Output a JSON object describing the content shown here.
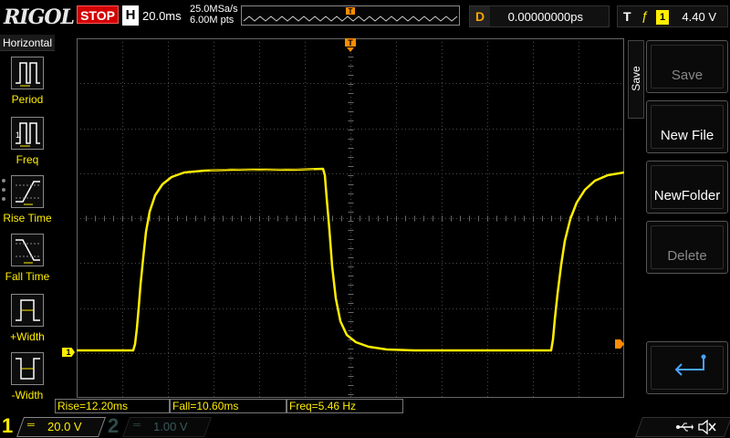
{
  "header": {
    "logo": "RIGOL",
    "run_status": "STOP",
    "timebase_letter": "H",
    "timebase": "20.0ms",
    "sample_rate": "25.0MSa/s",
    "memory_depth": "6.00M pts",
    "delay_letter": "D",
    "delay": "0.00000000ps",
    "trigger_letter": "T",
    "trigger_source": "1",
    "trigger_level": "4.40 V"
  },
  "left_menu": {
    "title": "Horizontal",
    "items": [
      {
        "label": "Period",
        "icon": "period-icon"
      },
      {
        "label": "Freq",
        "icon": "freq-icon"
      },
      {
        "label": "Rise Time",
        "icon": "rise-time-icon"
      },
      {
        "label": "Fall Time",
        "icon": "fall-time-icon"
      },
      {
        "label": "+Width",
        "icon": "plus-width-icon"
      },
      {
        "label": "-Width",
        "icon": "minus-width-icon"
      }
    ]
  },
  "right_menu": {
    "tab_label": "Save",
    "keys": [
      {
        "label": "Save",
        "enabled": false
      },
      {
        "label": "New File",
        "enabled": true
      },
      {
        "label": "NewFolder",
        "enabled": true
      },
      {
        "label": "Delete",
        "enabled": false
      },
      {
        "label": "",
        "icon": "return-arrow-icon",
        "enabled": true
      }
    ]
  },
  "measurements": {
    "rise": "Rise=12.20ms",
    "fall": "Fall=10.60ms",
    "freq": "Freq=5.46 Hz"
  },
  "channels": {
    "ch1": {
      "number": "1",
      "coupling": "═",
      "scale": "20.0 V",
      "color": "#ffee00"
    },
    "ch2": {
      "number": "2",
      "coupling": "═",
      "scale": "1.00 V",
      "color": "#2e4a4a"
    }
  },
  "markers": {
    "ch1_ground": "1",
    "trigger_position": "T"
  },
  "colors": {
    "trace": "#ffee00",
    "grid": "#444444",
    "accent": "#ff8c00",
    "stop": "#d40000"
  }
}
